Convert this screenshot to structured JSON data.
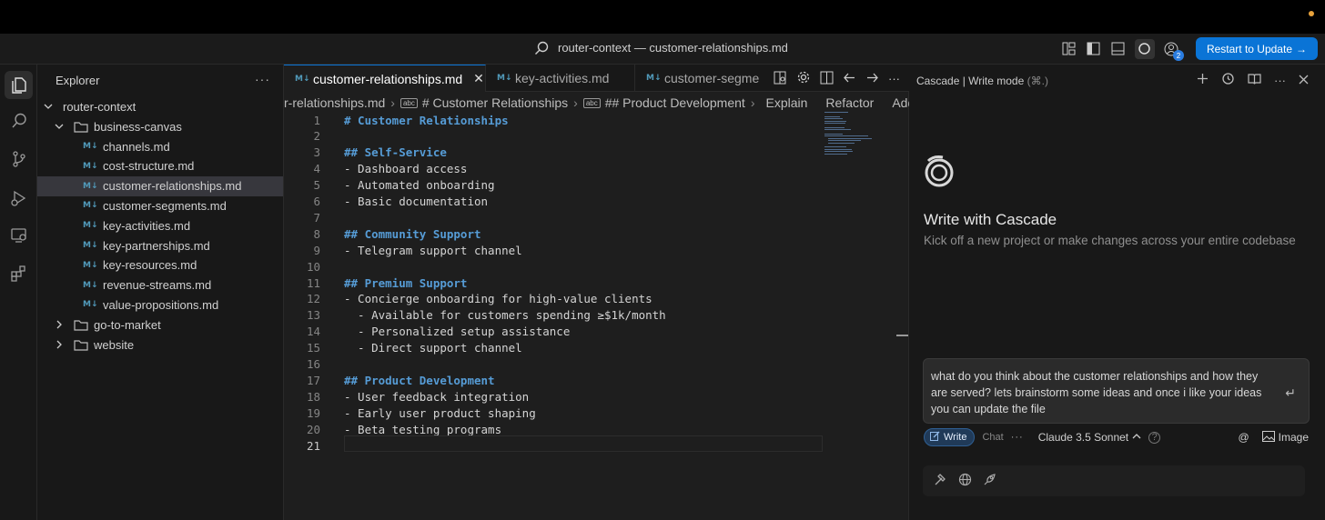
{
  "window": {
    "title": "router-context — customer-relationships.md",
    "update_button": "Restart to Update",
    "update_arrow": "→",
    "account_badge": "2"
  },
  "explorer": {
    "title": "Explorer",
    "more": "···",
    "root": "router-context",
    "folder_open": "business-canvas",
    "files": [
      "channels.md",
      "cost-structure.md",
      "customer-relationships.md",
      "customer-segments.md",
      "key-activities.md",
      "key-partnerships.md",
      "key-resources.md",
      "revenue-streams.md",
      "value-propositions.md"
    ],
    "selected_file": "customer-relationships.md",
    "folders_closed": [
      "go-to-market",
      "website"
    ],
    "md_badge": "M↓"
  },
  "tabs": [
    {
      "label": "customer-relationships.md",
      "active": true,
      "close": "✕"
    },
    {
      "label": "key-activities.md",
      "active": false
    },
    {
      "label": "customer-segme",
      "active": false
    }
  ],
  "breadcrumbs": {
    "file": "r-relationships.md",
    "h1": "# Customer Relationships",
    "h2": "## Product Development",
    "sep": "›",
    "abc": "abc",
    "actions": [
      "Explain",
      "Refactor",
      "Add Doc"
    ]
  },
  "code": {
    "current_line": 21,
    "lines": [
      {
        "n": "1",
        "type": "h1",
        "text": "# Customer Relationships"
      },
      {
        "n": "2",
        "type": "blank",
        "text": ""
      },
      {
        "n": "3",
        "type": "h2",
        "text": "## Self-Service"
      },
      {
        "n": "4",
        "type": "li",
        "text": "- Dashboard access"
      },
      {
        "n": "5",
        "type": "li",
        "text": "- Automated onboarding"
      },
      {
        "n": "6",
        "type": "li",
        "text": "- Basic documentation"
      },
      {
        "n": "7",
        "type": "blank",
        "text": ""
      },
      {
        "n": "8",
        "type": "h2",
        "text": "## Community Support"
      },
      {
        "n": "9",
        "type": "li",
        "text": "- Telegram support channel"
      },
      {
        "n": "10",
        "type": "blank",
        "text": ""
      },
      {
        "n": "11",
        "type": "h2",
        "text": "## Premium Support"
      },
      {
        "n": "12",
        "type": "li",
        "text": "- Concierge onboarding for high-value clients"
      },
      {
        "n": "13",
        "type": "li",
        "text": "  - Available for customers spending ≥$1k/month"
      },
      {
        "n": "14",
        "type": "li",
        "text": "  - Personalized setup assistance"
      },
      {
        "n": "15",
        "type": "li",
        "text": "  - Direct support channel"
      },
      {
        "n": "16",
        "type": "blank",
        "text": ""
      },
      {
        "n": "17",
        "type": "h2",
        "text": "## Product Development"
      },
      {
        "n": "18",
        "type": "li",
        "text": "- User feedback integration"
      },
      {
        "n": "19",
        "type": "li",
        "text": "- Early user product shaping"
      },
      {
        "n": "20",
        "type": "li",
        "text": "- Beta testing programs"
      },
      {
        "n": "21",
        "type": "blank",
        "text": ""
      }
    ]
  },
  "cascade": {
    "panel_title": "Cascade | Write mode",
    "shortcut": "(⌘.)",
    "heading": "Write with Cascade",
    "subheading": "Kick off a new project or make changes across your entire codebase",
    "input_value": "what do you think about the customer relationships and how they are served? lets brainstorm some ideas and once i like your ideas you can update the file",
    "enter_glyph": "↵",
    "mode_write": "Write",
    "mode_chat": "Chat",
    "mode_more": "···",
    "model": "Claude 3.5 Sonnet",
    "model_chevron": "^",
    "help": "?",
    "mention": "@",
    "image_label": "Image"
  },
  "colors": {
    "accent": "#0a74d6",
    "heading": "#569cd6",
    "md_icon": "#519aba"
  }
}
